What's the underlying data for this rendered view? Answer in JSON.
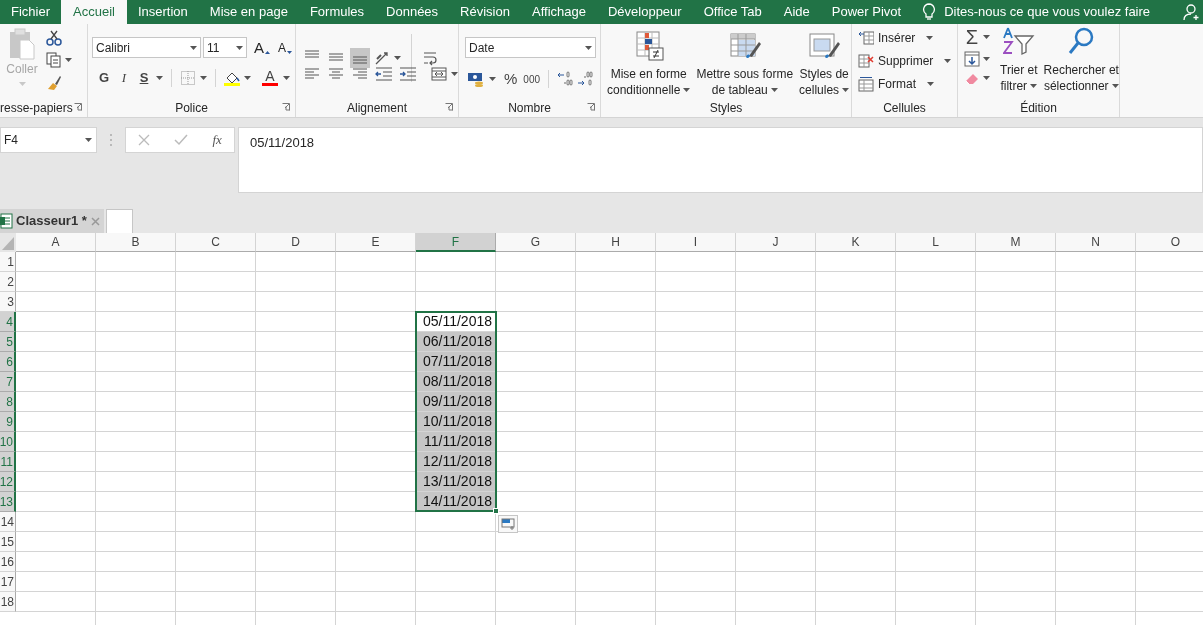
{
  "tabs": [
    {
      "label": "Fichier",
      "selected": false
    },
    {
      "label": "Accueil",
      "selected": true
    },
    {
      "label": "Insertion",
      "selected": false
    },
    {
      "label": "Mise en page",
      "selected": false
    },
    {
      "label": "Formules",
      "selected": false
    },
    {
      "label": "Données",
      "selected": false
    },
    {
      "label": "Révision",
      "selected": false
    },
    {
      "label": "Affichage",
      "selected": false
    },
    {
      "label": "Développeur",
      "selected": false
    },
    {
      "label": "Office Tab",
      "selected": false
    },
    {
      "label": "Aide",
      "selected": false
    },
    {
      "label": "Power Pivot",
      "selected": false
    }
  ],
  "tell_me": "Dites-nous ce que vous voulez faire",
  "ribbon": {
    "groups": [
      {
        "kind": "clipboard",
        "label": "resse-papiers",
        "dialog_launcher": true,
        "paste_label": "Coller",
        "paste_disabled": true
      },
      {
        "kind": "font",
        "label": "Police",
        "dialog_launcher": true,
        "font_name": "Calibri",
        "font_size": "11",
        "grow_glyph": "A",
        "shrink_glyph": "A",
        "bold_glyph": "G",
        "italic_glyph": "I",
        "underline_glyph": "S",
        "font_color_glyph": "A"
      },
      {
        "kind": "alignment",
        "label": "Alignement",
        "dialog_launcher": true,
        "vertical_align_buttons": [
          {
            "selected": false
          },
          {
            "selected": false
          },
          {
            "selected": true
          }
        ]
      },
      {
        "kind": "number",
        "label": "Nombre",
        "dialog_launcher": true,
        "format": "Date",
        "percent_glyph": "%",
        "thousands_glyph": "000"
      },
      {
        "kind": "styles",
        "label": "Styles",
        "buttons": [
          [
            "Mise en forme",
            "conditionnelle"
          ],
          [
            "Mettre sous forme",
            "de tableau"
          ],
          [
            "Styles de",
            "cellules"
          ]
        ]
      },
      {
        "kind": "cells",
        "label": "Cellules",
        "buttons": [
          "Insérer",
          "Supprimer",
          "Format"
        ]
      },
      {
        "kind": "editing",
        "label": "Édition",
        "sum_glyph": "Σ",
        "buttons": [
          [
            "Trier et",
            "filtrer"
          ],
          [
            "Rechercher et",
            "sélectionner"
          ]
        ]
      }
    ]
  },
  "formula_bar": {
    "name_box": "F4",
    "fx": "fx",
    "formula": "05/11/2018"
  },
  "workbook_tab": {
    "label": "Classeur1 *"
  },
  "grid": {
    "columns": [
      {
        "label": "A",
        "selected": false
      },
      {
        "label": "B",
        "selected": false
      },
      {
        "label": "C",
        "selected": false
      },
      {
        "label": "D",
        "selected": false
      },
      {
        "label": "E",
        "selected": false
      },
      {
        "label": "F",
        "selected": true
      },
      {
        "label": "G",
        "selected": false
      },
      {
        "label": "H",
        "selected": false
      },
      {
        "label": "I",
        "selected": false
      },
      {
        "label": "J",
        "selected": false
      },
      {
        "label": "K",
        "selected": false
      },
      {
        "label": "L",
        "selected": false
      },
      {
        "label": "M",
        "selected": false
      },
      {
        "label": "N",
        "selected": false
      },
      {
        "label": "O",
        "selected": false
      }
    ],
    "rows": [
      {
        "label": "1",
        "selected": false
      },
      {
        "label": "2",
        "selected": false
      },
      {
        "label": "3",
        "selected": false
      },
      {
        "label": "4",
        "selected": true,
        "cells": [
          null,
          null,
          null,
          null,
          null,
          {
            "value": "05/11/2018",
            "selected": true,
            "active": true
          }
        ]
      },
      {
        "label": "5",
        "selected": true,
        "cells": [
          null,
          null,
          null,
          null,
          null,
          {
            "value": "06/11/2018",
            "selected": true,
            "active": false
          }
        ]
      },
      {
        "label": "6",
        "selected": true,
        "cells": [
          null,
          null,
          null,
          null,
          null,
          {
            "value": "07/11/2018",
            "selected": true,
            "active": false
          }
        ]
      },
      {
        "label": "7",
        "selected": true,
        "cells": [
          null,
          null,
          null,
          null,
          null,
          {
            "value": "08/11/2018",
            "selected": true,
            "active": false
          }
        ]
      },
      {
        "label": "8",
        "selected": true,
        "cells": [
          null,
          null,
          null,
          null,
          null,
          {
            "value": "09/11/2018",
            "selected": true,
            "active": false
          }
        ]
      },
      {
        "label": "9",
        "selected": true,
        "cells": [
          null,
          null,
          null,
          null,
          null,
          {
            "value": "10/11/2018",
            "selected": true,
            "active": false
          }
        ]
      },
      {
        "label": "10",
        "selected": true,
        "cells": [
          null,
          null,
          null,
          null,
          null,
          {
            "value": "11/11/2018",
            "selected": true,
            "active": false
          }
        ]
      },
      {
        "label": "11",
        "selected": true,
        "cells": [
          null,
          null,
          null,
          null,
          null,
          {
            "value": "12/11/2018",
            "selected": true,
            "active": false
          }
        ]
      },
      {
        "label": "12",
        "selected": true,
        "cells": [
          null,
          null,
          null,
          null,
          null,
          {
            "value": "13/11/2018",
            "selected": true,
            "active": false
          }
        ]
      },
      {
        "label": "13",
        "selected": true,
        "cells": [
          null,
          null,
          null,
          null,
          null,
          {
            "value": "14/11/2018",
            "selected": true,
            "active": false
          }
        ]
      },
      {
        "label": "14",
        "selected": false
      },
      {
        "label": "15",
        "selected": false
      },
      {
        "label": "16",
        "selected": false
      },
      {
        "label": "17",
        "selected": false
      },
      {
        "label": "18",
        "selected": false
      }
    ]
  }
}
